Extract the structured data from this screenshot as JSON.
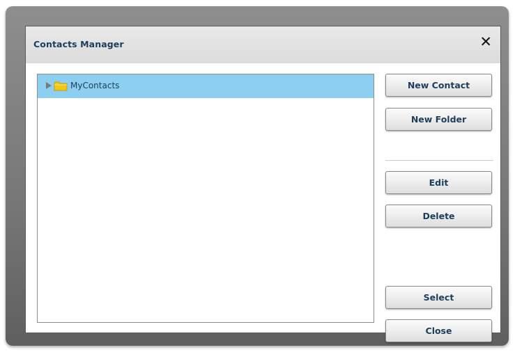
{
  "dialog": {
    "title": "Contacts Manager",
    "close_glyph": "✕"
  },
  "tree": {
    "items": [
      {
        "label": "MyContacts",
        "icon": "folder-icon",
        "expand_icon": "expand-arrow-icon",
        "selected": true,
        "expanded": false
      }
    ]
  },
  "buttons": {
    "new_contact": "New Contact",
    "new_folder": "New Folder",
    "edit": "Edit",
    "delete": "Delete",
    "select": "Select",
    "close": "Close"
  },
  "colors": {
    "selection": "#8ccff0",
    "title_text": "#1d3d5a",
    "folder": "#f5c518"
  }
}
